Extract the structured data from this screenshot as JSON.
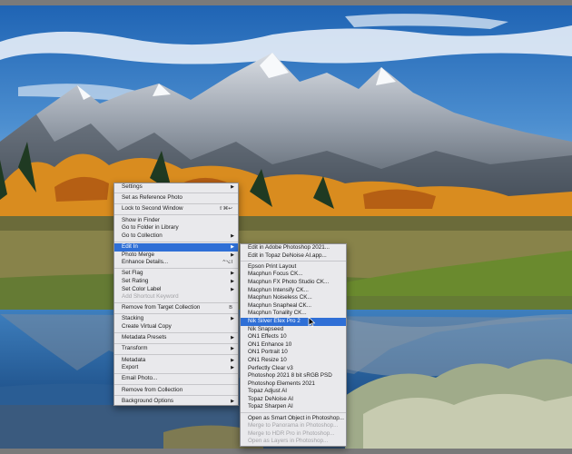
{
  "context_menu": {
    "items": [
      {
        "label": "Settings",
        "arrow": true
      },
      {
        "sep": true
      },
      {
        "label": "Set as Reference Photo"
      },
      {
        "sep": true
      },
      {
        "label": "Lock to Second Window",
        "shortcut": "⇧⌘↩"
      },
      {
        "sep": true
      },
      {
        "label": "Show in Finder"
      },
      {
        "label": "Go to Folder in Library"
      },
      {
        "label": "Go to Collection",
        "arrow": true
      },
      {
        "sep": true
      },
      {
        "label": "Edit In",
        "arrow": true,
        "highlighted": true
      },
      {
        "label": "Photo Merge",
        "arrow": true
      },
      {
        "label": "Enhance Details...",
        "shortcut": "^⌥I"
      },
      {
        "sep": true
      },
      {
        "label": "Set Flag",
        "arrow": true
      },
      {
        "label": "Set Rating",
        "arrow": true
      },
      {
        "label": "Set Color Label",
        "arrow": true
      },
      {
        "label": "Add Shortcut Keyword",
        "disabled": true
      },
      {
        "sep": true
      },
      {
        "label": "Remove from Target Collection",
        "shortcut": "B"
      },
      {
        "sep": true
      },
      {
        "label": "Stacking",
        "arrow": true
      },
      {
        "label": "Create Virtual Copy"
      },
      {
        "sep": true
      },
      {
        "label": "Metadata Presets",
        "arrow": true
      },
      {
        "sep": true
      },
      {
        "label": "Transform",
        "arrow": true
      },
      {
        "sep": true
      },
      {
        "label": "Metadata",
        "arrow": true
      },
      {
        "label": "Export",
        "arrow": true
      },
      {
        "sep": true
      },
      {
        "label": "Email Photo..."
      },
      {
        "sep": true
      },
      {
        "label": "Remove from Collection"
      },
      {
        "sep": true
      },
      {
        "label": "Background Options",
        "arrow": true
      }
    ]
  },
  "edit_in_submenu": {
    "items": [
      {
        "label": "Edit in Adobe Photoshop 2021..."
      },
      {
        "label": "Edit in Topaz DeNoise AI.app..."
      },
      {
        "sep": true
      },
      {
        "label": "Epson Print Layout"
      },
      {
        "label": "Macphun Focus CK..."
      },
      {
        "label": "Macphun FX Photo Studio CK..."
      },
      {
        "label": "Macphun Intensify CK..."
      },
      {
        "label": "Macphun Noiseless CK..."
      },
      {
        "label": "Macphun Snapheal CK..."
      },
      {
        "label": "Macphun Tonality CK..."
      },
      {
        "label": "Nik Silver Efex Pro 2",
        "highlighted": true
      },
      {
        "label": "Nik Snapseed"
      },
      {
        "label": "ON1 Effects 10"
      },
      {
        "label": "ON1 Enhance 10"
      },
      {
        "label": "ON1 Portrait 10"
      },
      {
        "label": "ON1 Resize 10"
      },
      {
        "label": "Perfectly Clear v3"
      },
      {
        "label": "Photoshop 2021 8 bit sRGB PSD"
      },
      {
        "label": "Photoshop Elements 2021"
      },
      {
        "label": "Topaz Adjust AI"
      },
      {
        "label": "Topaz DeNoise AI"
      },
      {
        "label": "Topaz Sharpen AI"
      },
      {
        "sep": true
      },
      {
        "label": "Open as Smart Object in Photoshop..."
      },
      {
        "label": "Merge to Panorama in Photoshop...",
        "disabled": true
      },
      {
        "label": "Merge to HDR Pro in Photoshop...",
        "disabled": true
      },
      {
        "label": "Open as Layers in Photoshop...",
        "disabled": true
      }
    ]
  },
  "icons": {
    "submenu_arrow": "▶",
    "cursor": "arrow-pointer-icon"
  },
  "colors": {
    "highlight": "#2f6fd6",
    "menu_bg": "#e9e9ec",
    "frame": "#7a7a7a"
  }
}
